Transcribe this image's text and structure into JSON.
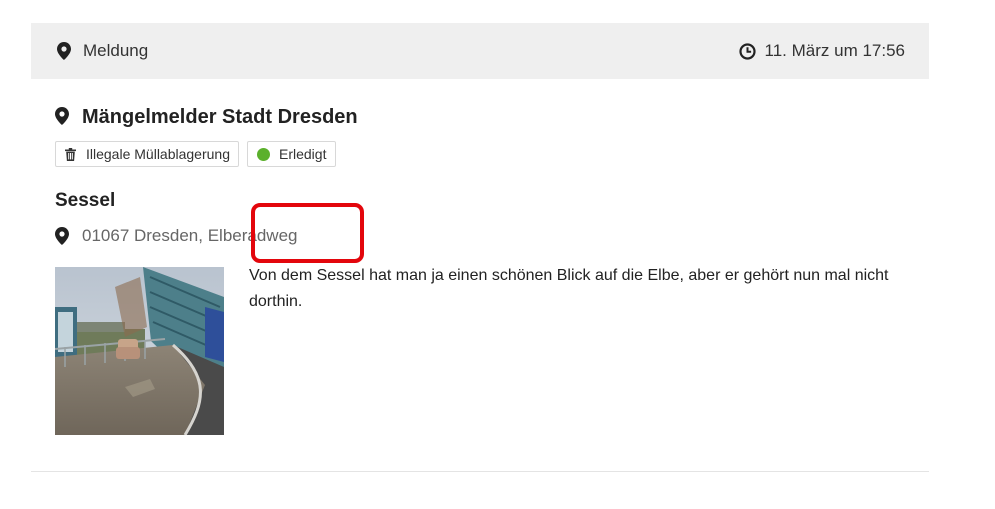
{
  "header": {
    "type_label": "Meldung",
    "timestamp": "11. März um 17:56"
  },
  "report": {
    "organization": "Mängelmelder Stadt Dresden",
    "category_tag": "Illegale Müllablagerung",
    "status_tag": "Erledigt",
    "status_color": "#5bb02c",
    "title": "Sessel",
    "address": "01067 Dresden, Elberadweg",
    "description": "Von dem Sessel hat man ja einen schönen Blick auf die Elbe, aber er gehört nun mal nicht dorthin."
  },
  "icons": {
    "header_left": "map-marker-icon",
    "header_right": "clock-icon",
    "organization": "map-marker-icon",
    "category": "trash-icon",
    "address": "map-marker-icon"
  },
  "highlight_color": "#e3060c"
}
